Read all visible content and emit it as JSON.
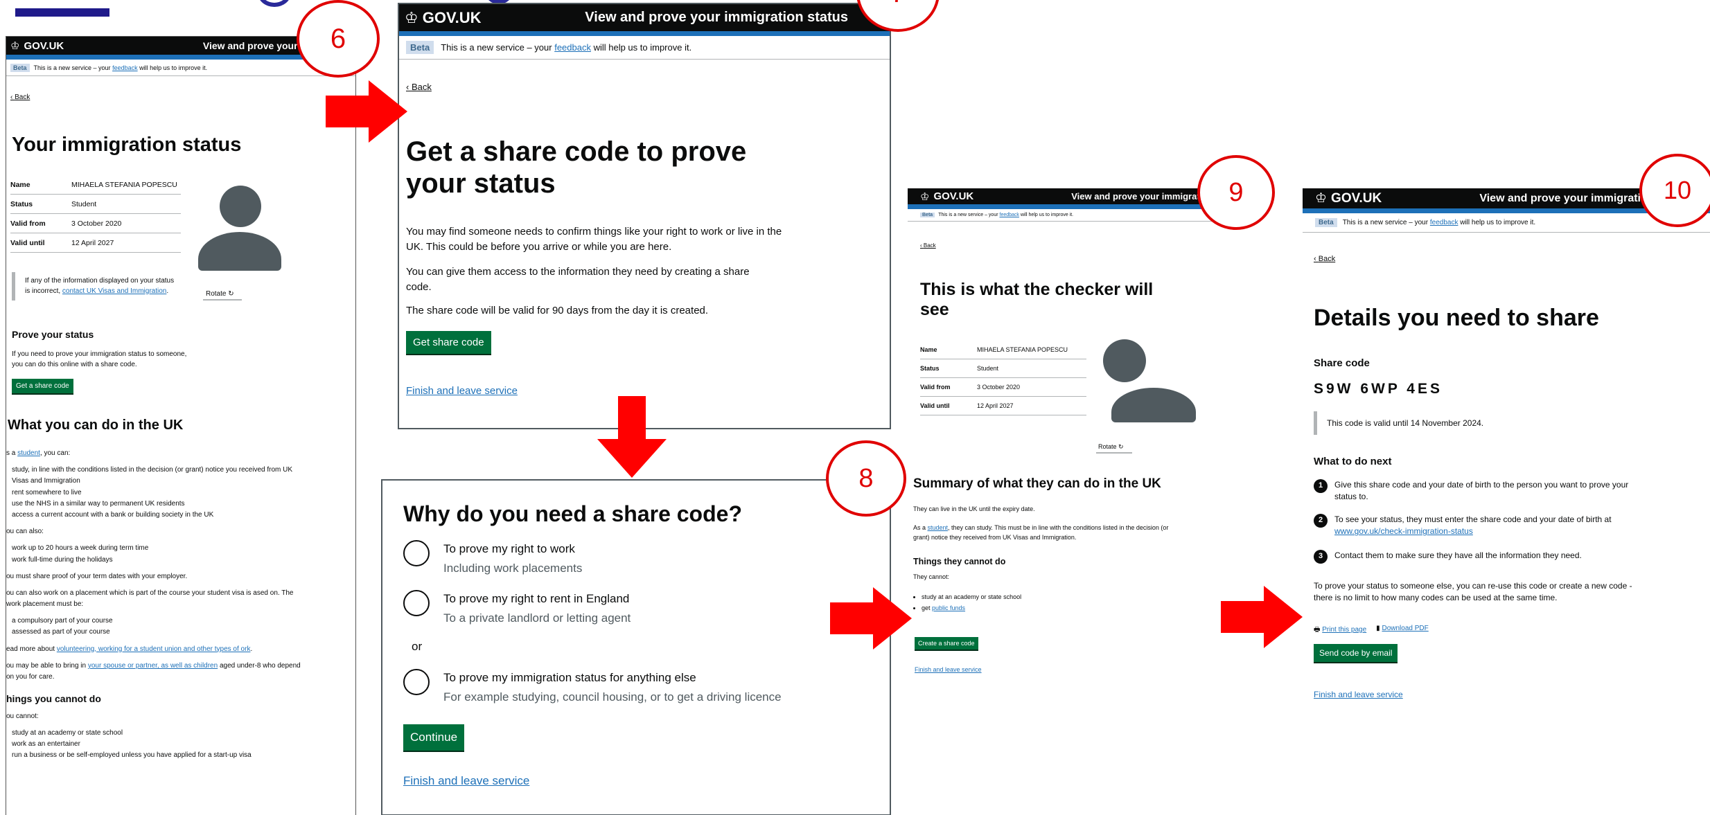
{
  "common": {
    "brand": "GOV.UK",
    "service_name": "View and prove your immigration status",
    "beta_tag": "Beta",
    "beta_prefix": "This is a new service – your ",
    "beta_link": "feedback",
    "beta_suffix": " will help us to improve it.",
    "back": "Back",
    "finish": "Finish and leave service"
  },
  "screen6": {
    "service_visible": "View and prove your immigratio",
    "title": "Your immigration status",
    "summary": [
      {
        "k": "Name",
        "v": "MIHAELA STEFANIA POPESCU"
      },
      {
        "k": "Status",
        "v": "Student"
      },
      {
        "k": "Valid from",
        "v": "3 October 2020"
      },
      {
        "k": "Valid until",
        "v": "12 April 2027"
      }
    ],
    "inset_text": "If any of the information displayed on your status is incorrect, ",
    "inset_link": "contact UK Visas and Immigration",
    "inset_end": ".",
    "rotate": "Rotate ↻",
    "prove_heading": "Prove your status",
    "prove_text": "If you need to prove your immigration status to someone, you can do this online with a share code.",
    "prove_button": "Get a share code",
    "what_heading": "What you can do in the UK",
    "as_a": "s a ",
    "student_link": "student",
    "you_can": ", you can:",
    "can_list": [
      "study, in line with the conditions listed in the decision (or grant) notice you received from UK Visas and Immigration",
      "rent somewhere to live",
      "use the NHS in a similar way to permanent UK residents",
      "access a current account with a bank or building society in the UK"
    ],
    "also": "ou can also:",
    "also_list": [
      "work up to 20 hours a week during term time",
      "work full-time during the holidays"
    ],
    "proof": "ou must share proof of your term dates with your employer.",
    "placement": "ou can also work on a placement which is part of the course your student visa is ased on. The work placement must be:",
    "placement_list": [
      "a compulsory part of your course",
      "assessed as part of your course"
    ],
    "read_more": "ead more about ",
    "read_more_link": "volunteering, working for a student union and other types of ork",
    "read_more_end": ".",
    "bring": "ou may be able to bring in ",
    "bring_link": "your spouse or partner, as well as children",
    "bring_end": " aged under-8 who depend on you for care.",
    "cannot_heading": "hings you cannot do",
    "cannot": "ou cannot:",
    "cannot_list": [
      "study at an academy or state school",
      "work as an entertainer",
      "run a business or be self-employed unless you have applied for a start-up visa"
    ]
  },
  "screen7": {
    "title": "Get a share code to prove your status",
    "p1": "You may find someone needs to confirm things like your right to work or live in the UK. This could be before you arrive or while you are here.",
    "p2": "You can give them access to the information they need by creating a share code.",
    "p3": "The share code will be valid for 90 days from the day it is created.",
    "button": "Get share code"
  },
  "screen8": {
    "title": "Why do you need a share code?",
    "options": [
      {
        "label": "To prove my right to work",
        "hint": "Including work placements"
      },
      {
        "label": "To prove my right to rent in England",
        "hint": "To a private landlord or letting agent"
      }
    ],
    "or": "or",
    "option3": {
      "label": "To prove my immigration status for anything else",
      "hint": "For example studying, council housing, or to get a driving licence"
    },
    "button": "Continue"
  },
  "screen9": {
    "service_visible": "View and prove your immigration s",
    "title": "This is what the checker will see",
    "summary": [
      {
        "k": "Name",
        "v": "MIHAELA STEFANIA POPESCU"
      },
      {
        "k": "Status",
        "v": "Student"
      },
      {
        "k": "Valid from",
        "v": "3 October 2020"
      },
      {
        "k": "Valid until",
        "v": "12 April 2027"
      }
    ],
    "rotate": "Rotate ↻",
    "summary_heading": "Summary of what they can do in the UK",
    "live": "They can live in the UK until the expiry date.",
    "as_a": "As a ",
    "student_link": "student",
    "study": ", they can study. This must be in line with the conditions listed in the decision (or grant) notice they received from UK Visas and Immigration.",
    "cannot_heading": "Things they cannot do",
    "cannot": "They cannot:",
    "cannot_item1": "study at an academy or state school",
    "cannot_item2_pre": "get ",
    "cannot_item2_link": "public funds",
    "button": "Create a share code"
  },
  "screen10": {
    "service_visible": "View and prove your immigrati",
    "title": "Details you need to share",
    "code_label": "Share code",
    "code": "S9W 6WP 4ES",
    "valid": "This code is valid until 14 November 2024.",
    "next_heading": "What to do next",
    "steps": [
      {
        "n": "1",
        "text": "Give this share code and your date of birth to the person you want to prove your status to."
      },
      {
        "n": "2",
        "text": "To see your status, they must enter the share code and your date of birth at ",
        "link": "www.gov.uk/check-immigration-status"
      },
      {
        "n": "3",
        "text": "Contact them to make sure they have all the information they need."
      }
    ],
    "reuse": "To prove your status to someone else, you can re-use this code or create a new code - there is no limit to how many codes can be used at the same time.",
    "print": "Print this page",
    "download": "Download PDF",
    "button": "Send code by email"
  },
  "markers": [
    "6",
    "7",
    "8",
    "9",
    "10"
  ],
  "colors": {
    "arrow": "#ff0000",
    "marker": "#e00000",
    "govuk_black": "#0b0c0c",
    "govuk_blue": "#1d70b8",
    "govuk_green": "#00703c"
  }
}
